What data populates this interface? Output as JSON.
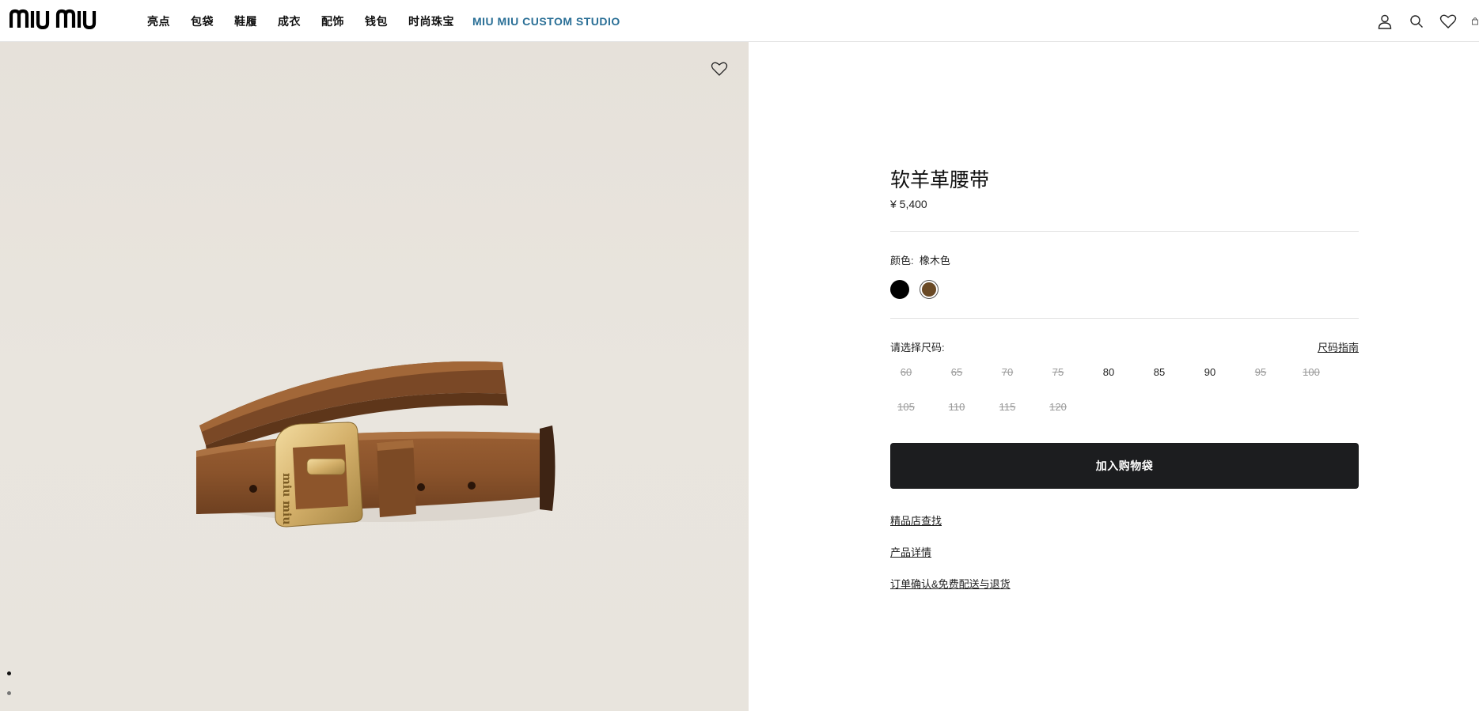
{
  "header": {
    "logo_text": "MIU MIU",
    "nav": [
      "亮点",
      "包袋",
      "鞋履",
      "成衣",
      "配饰",
      "钱包",
      "时尚珠宝",
      "MIU MIU CUSTOM STUDIO"
    ],
    "icons": [
      "user-icon",
      "search-icon",
      "heart-icon",
      "bag-icon"
    ]
  },
  "product": {
    "title": "软羊革腰带",
    "price": "¥ 5,400",
    "color_label": "颜色:",
    "color_value": "橡木色",
    "swatches": [
      {
        "name": "black",
        "color": "#000000",
        "selected": false
      },
      {
        "name": "oak",
        "color": "#6a4a26",
        "selected": true
      }
    ],
    "size_label": "请选择尺码:",
    "size_guide": "尺码指南",
    "sizes": [
      {
        "label": "60",
        "available": false
      },
      {
        "label": "65",
        "available": false
      },
      {
        "label": "70",
        "available": false
      },
      {
        "label": "75",
        "available": false
      },
      {
        "label": "80",
        "available": true
      },
      {
        "label": "85",
        "available": true
      },
      {
        "label": "90",
        "available": true
      },
      {
        "label": "95",
        "available": false
      },
      {
        "label": "100",
        "available": false
      },
      {
        "label": "105",
        "available": false
      },
      {
        "label": "110",
        "available": false
      },
      {
        "label": "115",
        "available": false
      },
      {
        "label": "120",
        "available": false
      }
    ],
    "add_to_bag": "加入购物袋",
    "links": {
      "store_finder": "精品店查找",
      "details": "产品详情",
      "shipping": "订单确认&免费配送与退货"
    }
  },
  "gallery": {
    "slide_count": 2,
    "active_slide": 1
  },
  "colors": {
    "nav_accent": "#2a6f96",
    "button_bg": "#1c1d1f",
    "image_bg": "#e8e4dd"
  }
}
